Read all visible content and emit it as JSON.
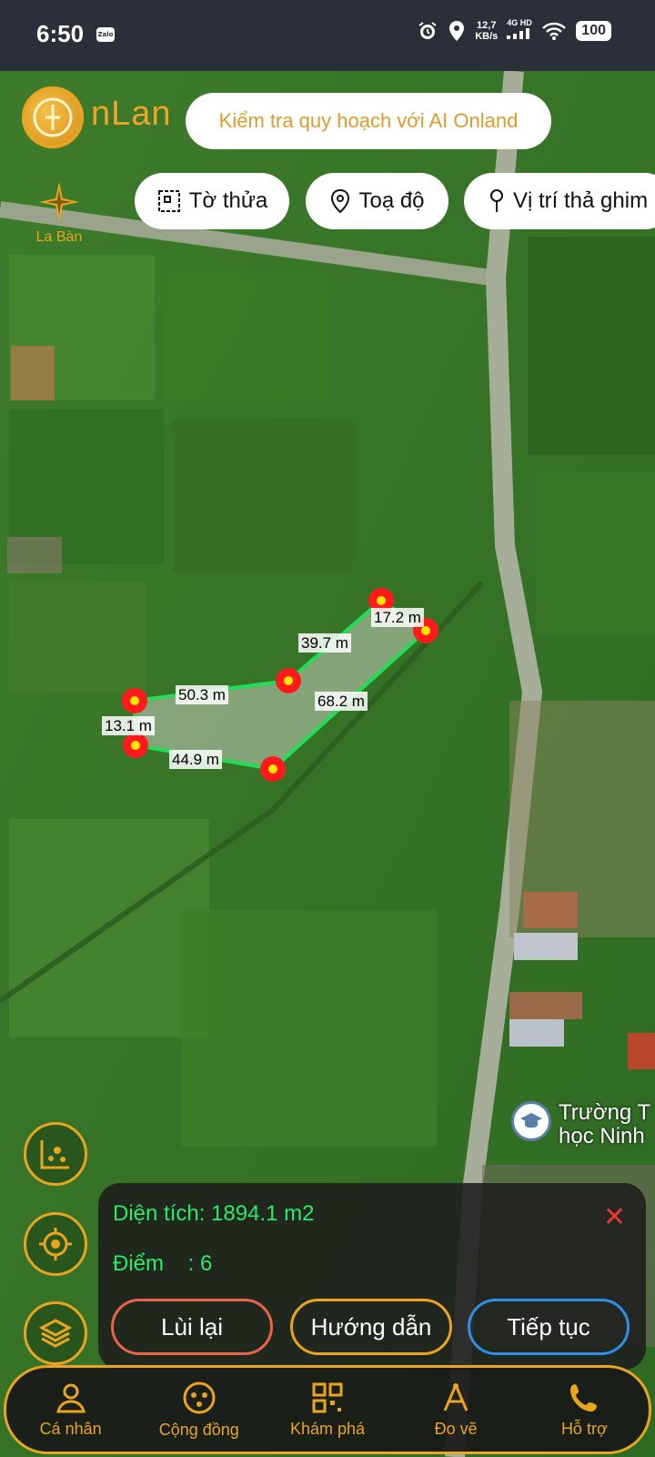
{
  "status_bar": {
    "time": "6:50",
    "app_notification": "Zalo",
    "net_speed_value": "12,7",
    "net_speed_unit": "KB/s",
    "network_type": "4G HD",
    "battery": "100",
    "icons": [
      "alarm-icon",
      "location-icon",
      "signal-icon",
      "wifi-icon",
      "battery-icon"
    ]
  },
  "header": {
    "brand_text": "nLan",
    "ai_button_label": "Kiểm tra quy hoạch với AI Onland",
    "compass_label": "La Bàn"
  },
  "chips": [
    {
      "label": "Tờ thửa",
      "icon": "parcel-icon"
    },
    {
      "label": "Toạ độ",
      "icon": "location-pin-icon"
    },
    {
      "label": "Vị trí thả ghim",
      "icon": "pushpin-icon"
    }
  ],
  "measurement": {
    "segments": [
      "17.2 m",
      "39.7 m",
      "50.3 m",
      "68.2 m",
      "13.1 m",
      "44.9 m"
    ],
    "area_label": "Diện tích: 1894.1 m2",
    "points_label": "Điểm    : 6"
  },
  "poi": {
    "line1": "Trường T",
    "line2": "học Ninh"
  },
  "actions": {
    "back": "Lùi lại",
    "guide": "Hướng dẫn",
    "next": "Tiếp tục"
  },
  "nav": [
    {
      "label": "Cá nhân",
      "icon": "person-icon"
    },
    {
      "label": "Cộng đồng",
      "icon": "community-icon"
    },
    {
      "label": "Khám phá",
      "icon": "grid-icon"
    },
    {
      "label": "Đo vẽ",
      "icon": "measure-draw-icon"
    },
    {
      "label": "Hỗ trợ",
      "icon": "phone-icon"
    }
  ],
  "colors": {
    "accent": "#e9a520",
    "measure_line": "#22dd55",
    "vertex": "#ff1a1a",
    "area_text": "#2ee86a",
    "close": "#e53935",
    "btn_back": "#e9624a",
    "btn_next": "#2f8fe8"
  }
}
